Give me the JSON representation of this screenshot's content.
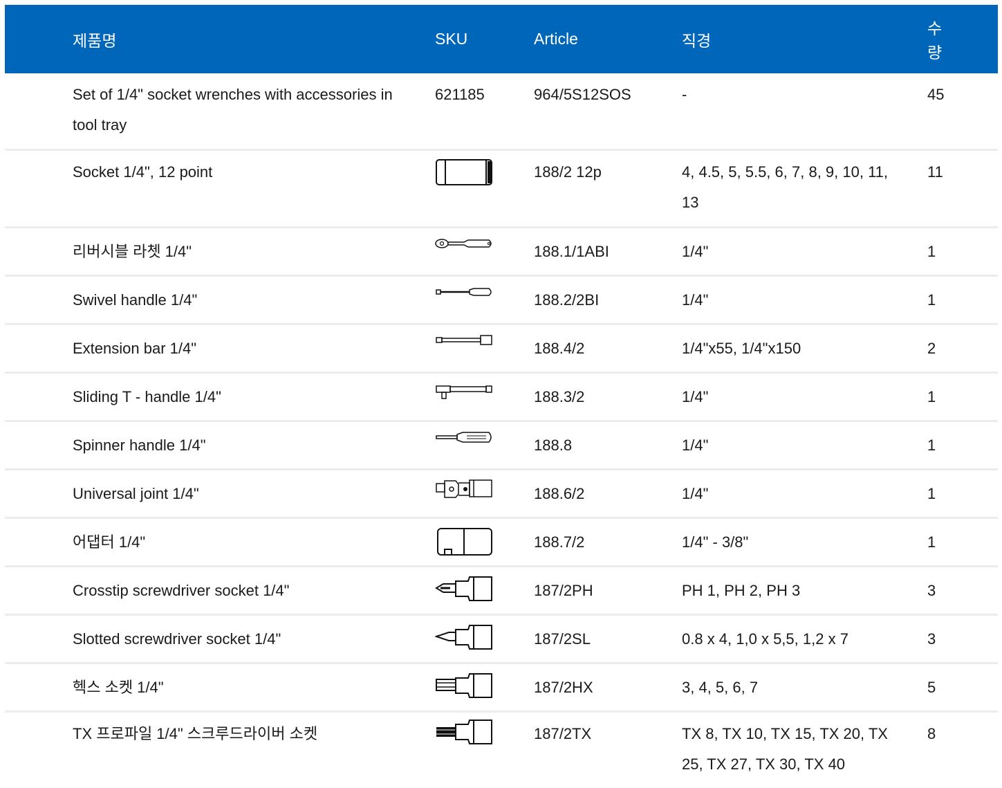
{
  "header": {
    "name": "제품명",
    "sku": "SKU",
    "article": "Article",
    "diameter": "직경",
    "quantity_line1": "수",
    "quantity_line2": "량"
  },
  "rows": [
    {
      "name": "Set of 1/4\" socket wrenches with accessories in tool tray",
      "sku": "621185",
      "icon": "",
      "article": "964/5S12SOS",
      "diameter": "-",
      "quantity": "45"
    },
    {
      "name": "Socket 1/4\", 12 point",
      "sku": "",
      "icon": "socket-icon",
      "article": "188/2 12p",
      "diameter": "4, 4.5, 5, 5.5, 6, 7, 8, 9, 10, 11, 13",
      "quantity": "11"
    },
    {
      "name": "리버시블 라쳇 1/4\"",
      "sku": "",
      "icon": "ratchet-icon",
      "article": "188.1/1ABI",
      "diameter": "1/4\"",
      "quantity": "1"
    },
    {
      "name": "Swivel handle 1/4\"",
      "sku": "",
      "icon": "swivel-handle-icon",
      "article": "188.2/2BI",
      "diameter": "1/4\"",
      "quantity": "1"
    },
    {
      "name": "Extension bar 1/4\"",
      "sku": "",
      "icon": "extension-bar-icon",
      "article": "188.4/2",
      "diameter": "1/4\"x55, 1/4\"x150",
      "quantity": "2"
    },
    {
      "name": "Sliding T - handle 1/4\"",
      "sku": "",
      "icon": "t-handle-icon",
      "article": "188.3/2",
      "diameter": "1/4\"",
      "quantity": "1"
    },
    {
      "name": "Spinner handle 1/4\"",
      "sku": "",
      "icon": "spinner-handle-icon",
      "article": "188.8",
      "diameter": "1/4\"",
      "quantity": "1"
    },
    {
      "name": "Universal joint 1/4\"",
      "sku": "",
      "icon": "universal-joint-icon",
      "article": "188.6/2",
      "diameter": "1/4\"",
      "quantity": "1"
    },
    {
      "name": "어댑터 1/4\"",
      "sku": "",
      "icon": "adapter-icon",
      "article": "188.7/2",
      "diameter": "1/4\" - 3/8\"",
      "quantity": "1"
    },
    {
      "name": "Crosstip screwdriver socket 1/4\"",
      "sku": "",
      "icon": "crosstip-socket-icon",
      "article": "187/2PH",
      "diameter": "PH 1, PH 2, PH 3",
      "quantity": "3"
    },
    {
      "name": "Slotted screwdriver socket 1/4\"",
      "sku": "",
      "icon": "slotted-socket-icon",
      "article": "187/2SL",
      "diameter": "0.8 x 4, 1,0 x 5,5, 1,2 x 7",
      "quantity": "3"
    },
    {
      "name": "헥스 소켓 1/4\"",
      "sku": "",
      "icon": "hex-socket-icon",
      "article": "187/2HX",
      "diameter": "3, 4, 5, 6, 7",
      "quantity": "5"
    },
    {
      "name": "TX 프로파일 1/4\" 스크루드라이버 소켓",
      "sku": "",
      "icon": "torx-socket-icon",
      "article": "187/2TX",
      "diameter": "TX 8, TX 10, TX 15, TX 20, TX 25, TX 27, TX 30, TX 40",
      "quantity": "8"
    }
  ]
}
